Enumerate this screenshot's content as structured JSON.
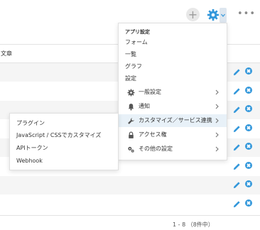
{
  "toolbar": {
    "add_icon": "plus-icon",
    "settings_icon": "gear-icon",
    "more_label": "•••"
  },
  "table": {
    "column_header": "文章",
    "row_count_shown": 8,
    "pagination": "1 - 8 （8件中）"
  },
  "settings_menu": {
    "heading": "アプリ設定",
    "items": [
      {
        "label": "フォーム"
      },
      {
        "label": "一覧"
      },
      {
        "label": "グラフ"
      },
      {
        "label": "設定"
      }
    ],
    "sub_items": [
      {
        "label": "一般設定",
        "icon": "gear-icon"
      },
      {
        "label": "通知",
        "icon": "bell-icon"
      },
      {
        "label": "カスタマイズ／サービス連携",
        "icon": "wrench-icon"
      },
      {
        "label": "アクセス権",
        "icon": "lock-icon"
      },
      {
        "label": "その他の設定",
        "icon": "gears-icon"
      }
    ]
  },
  "customize_submenu": {
    "items": [
      {
        "label": "プラグイン"
      },
      {
        "label": "JavaScript / CSSでカスタマイズ"
      },
      {
        "label": "APIトークン"
      },
      {
        "label": "Webhook"
      }
    ]
  },
  "colors": {
    "accent": "#3498db",
    "active_item": "#e8f1f8",
    "row_alt": "#f5f5f5"
  }
}
